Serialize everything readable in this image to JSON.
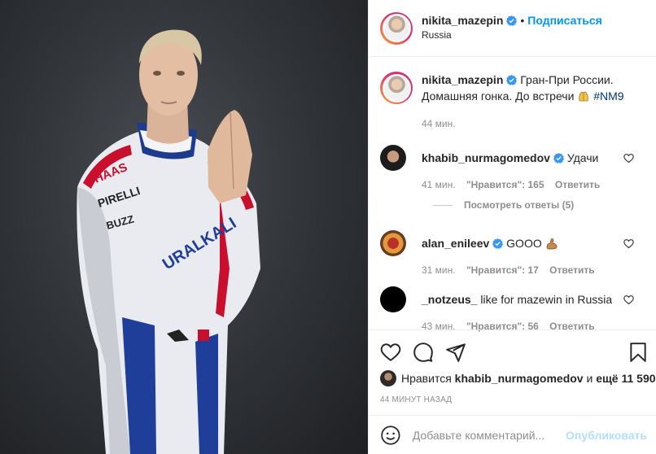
{
  "header": {
    "username": "nikita_mazepin",
    "follow_label": "Подписаться",
    "location": "Russia"
  },
  "caption": {
    "username": "nikita_mazepin",
    "text": "Гран-При России. Домашняя гонка. До встречи",
    "hashtag": "#NM9",
    "time": "44 мин."
  },
  "comments": [
    {
      "username": "khabib_nurmagomedov",
      "text": "Удачи",
      "time": "41 мин.",
      "likes": "\"Нравится\": 165",
      "reply_label": "Ответить",
      "verified": true
    },
    {
      "username": "alan_enileev",
      "text": "GOOO",
      "time": "31 мин.",
      "likes": "\"Нравится\": 17",
      "reply_label": "Ответить",
      "verified": true
    },
    {
      "username": "_notzeus_",
      "text": "like for mazewin in Russia",
      "time": "43 мин.",
      "likes": "\"Нравится\": 56",
      "reply_label": "Ответить",
      "verified": false
    }
  ],
  "view_replies": "Посмотреть ответы (5)",
  "likes_bar": {
    "prefix": "Нравится",
    "user": "khabib_nurmagomedov",
    "joiner": "и",
    "others": "ещё 11 590"
  },
  "post_date": "44 МИНУТ НАЗАД",
  "composer": {
    "placeholder": "Добавьте комментарий...",
    "publish_label": "Опубликовать"
  },
  "colors": {
    "link_blue": "#0095f6",
    "hashtag_blue": "#00376b",
    "muted": "#8e8e8e",
    "verified_blue": "#3897f0"
  },
  "icons": [
    "verified-icon",
    "heart-icon",
    "comment-icon",
    "share-icon",
    "bookmark-icon",
    "emoji-icon",
    "clapping-hands-icon",
    "flexed-biceps-icon"
  ]
}
